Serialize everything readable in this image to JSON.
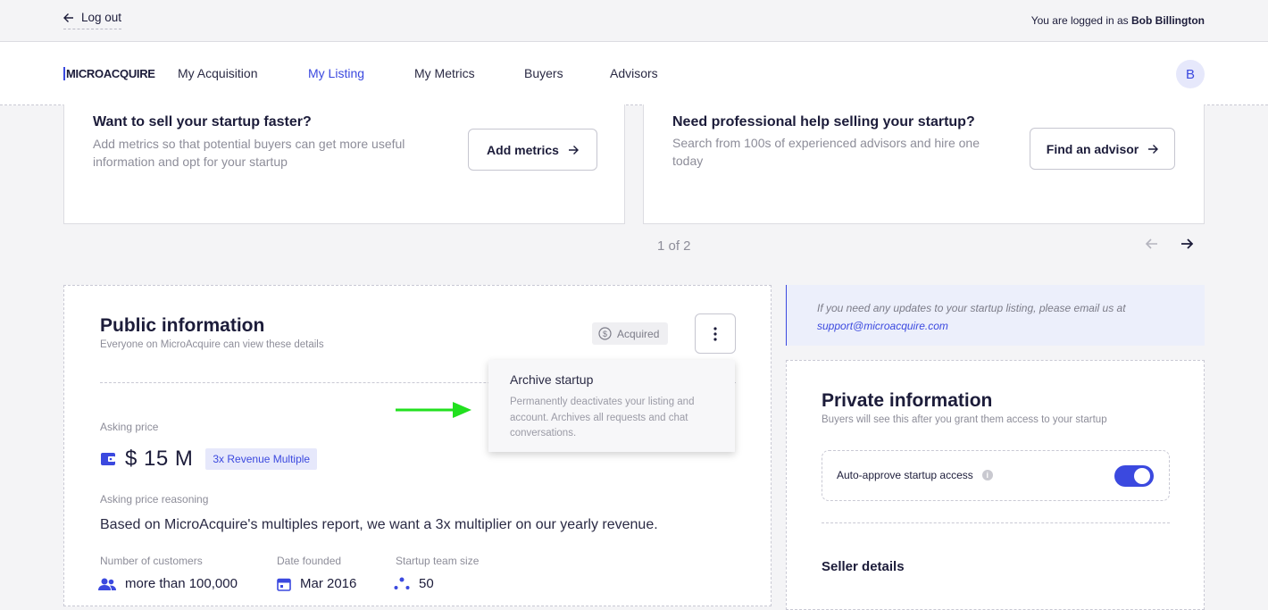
{
  "topbar": {
    "logout_label": "Log out",
    "logged_in_prefix": "You are logged in as",
    "user_name": "Bob Billington"
  },
  "nav": {
    "logo": "MICROACQUIRE",
    "items": [
      {
        "label": "My Acquisition"
      },
      {
        "label": "My Listing"
      },
      {
        "label": "My Metrics"
      },
      {
        "label": "Buyers"
      },
      {
        "label": "Advisors"
      }
    ],
    "active": "My Listing",
    "avatar_initial": "B"
  },
  "promos": [
    {
      "title": "Want to sell your startup faster?",
      "desc_line1": "Add metrics so that potential buyers can get more useful",
      "desc_line2": "information and opt for your startup",
      "button": "Add metrics"
    },
    {
      "title": "Need professional help selling your startup?",
      "desc_line1": "Search from 100s of experienced advisors and hire one",
      "desc_line2": "today",
      "button": "Find an advisor"
    }
  ],
  "pager": {
    "text": "1 of 2"
  },
  "public_info": {
    "title": "Public information",
    "subtitle": "Everyone on MicroAcquire can view these details",
    "status_badge": "Acquired",
    "asking_price_label": "Asking price",
    "asking_price": "$ 15 M",
    "multiple_badge": "3x Revenue Multiple",
    "reasoning_label": "Asking price reasoning",
    "reasoning": "Based on MicroAcquire's multiples report, we want a 3x multiplier on our yearly revenue.",
    "stats": [
      {
        "label": "Number of customers",
        "value": "more than 100,000"
      },
      {
        "label": "Date founded",
        "value": "Mar 2016"
      },
      {
        "label": "Startup team size",
        "value": "50"
      }
    ]
  },
  "dropdown": {
    "title": "Archive startup",
    "desc_line1": "Permanently deactivates your listing and",
    "desc_line2": "account. Archives all requests and chat",
    "desc_line3": "conversations."
  },
  "notice": {
    "text": "If you need any updates to your startup listing, please email us at",
    "email": "support@microacquire.com"
  },
  "private_info": {
    "title": "Private information",
    "subtitle": "Buyers will see this after you grant them access to your startup",
    "toggle_label": "Auto-approve startup access",
    "toggle_on": true,
    "seller_details": "Seller details"
  },
  "colors": {
    "accent": "#3b49df",
    "annotation_arrow": "#22e01f"
  }
}
